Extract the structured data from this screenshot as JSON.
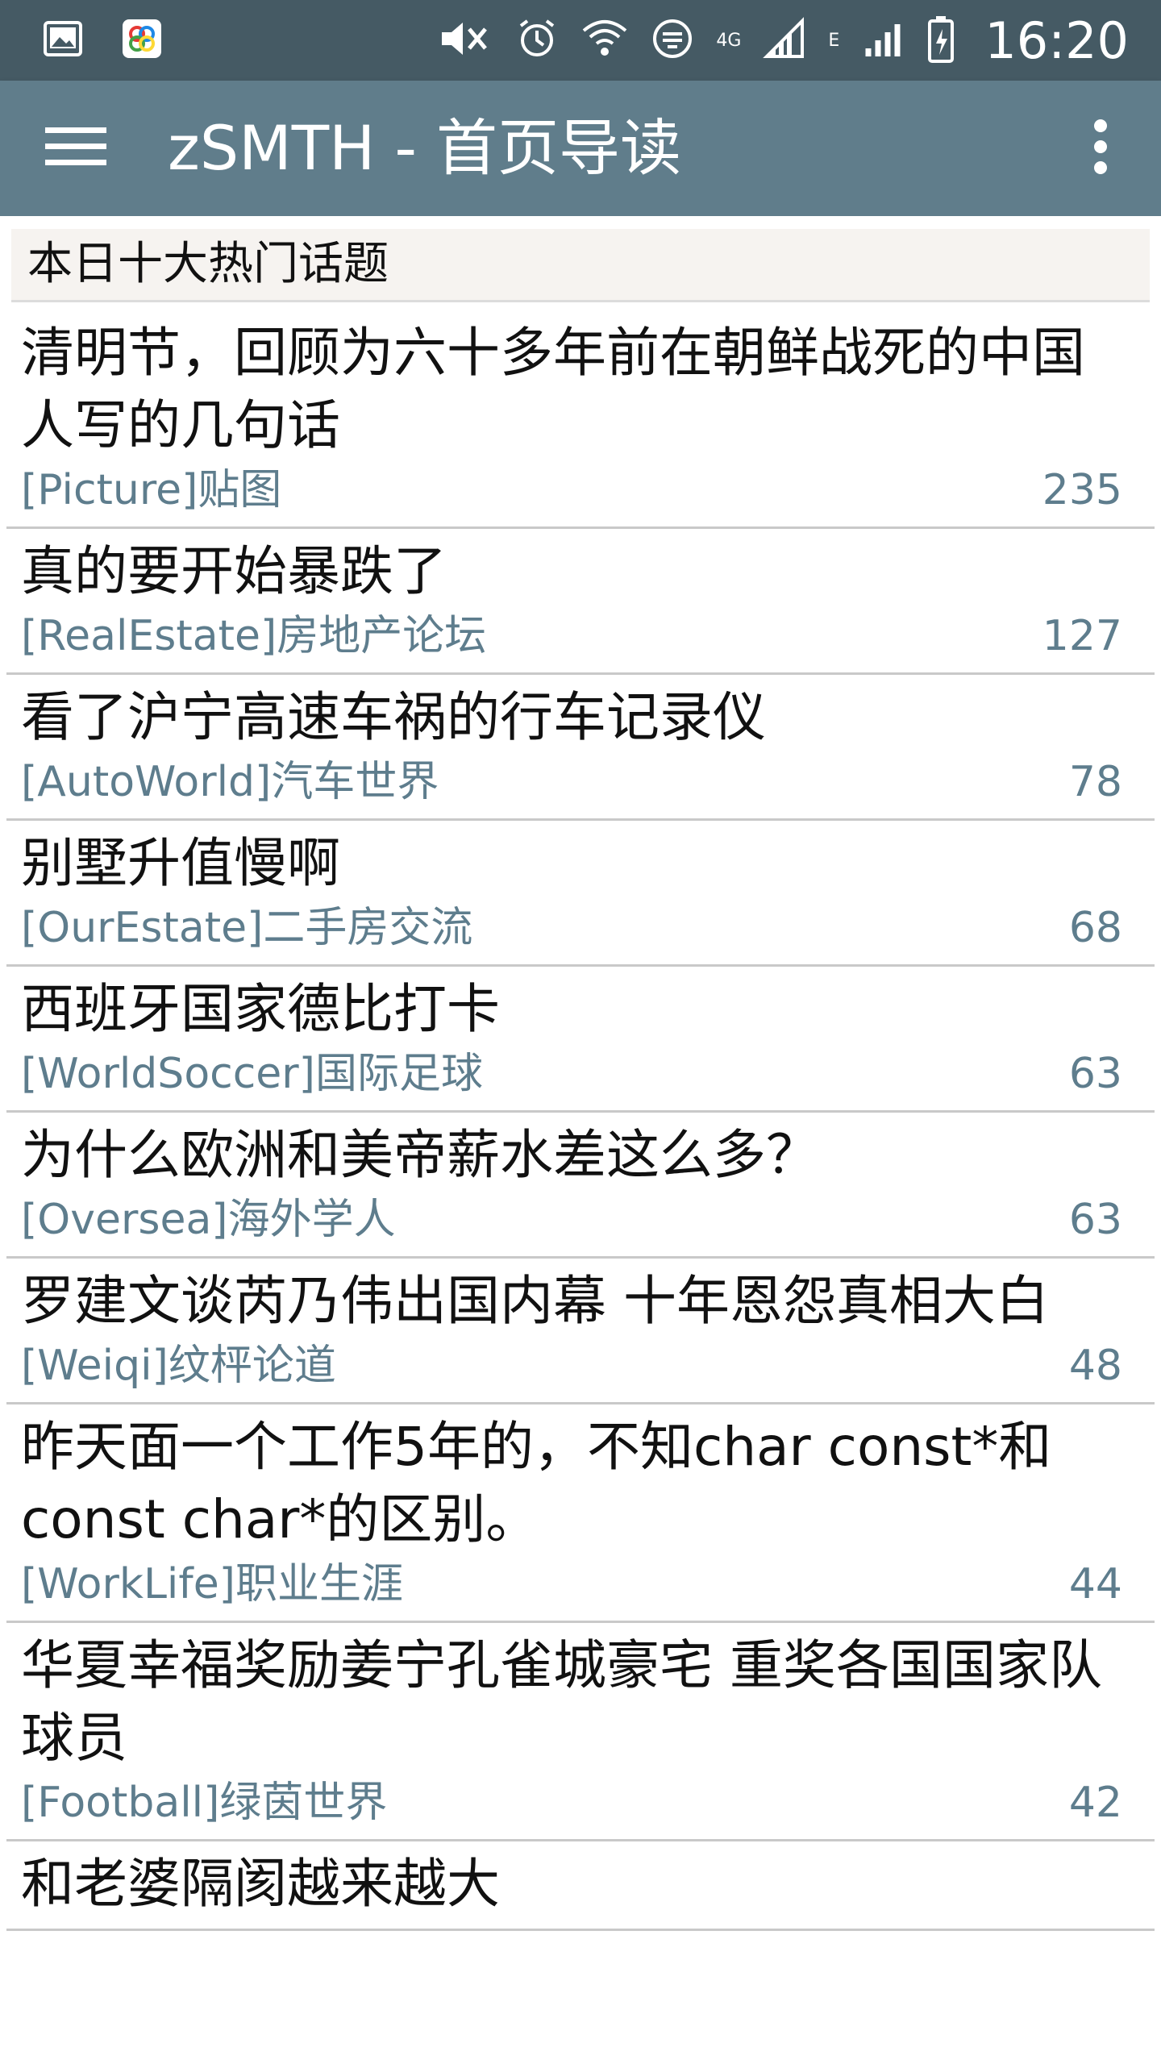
{
  "status_bar": {
    "time": "16:20",
    "network_4g": "4G",
    "network_e": "E",
    "icons": [
      "gallery-icon",
      "app-icon",
      "mute-icon",
      "alarm-icon",
      "wifi-icon",
      "sync-icon",
      "signal-icon",
      "signal-icon",
      "battery-icon"
    ]
  },
  "app_bar": {
    "title": "zSMTH - 首页导读",
    "menu_icon": "hamburger-menu-icon",
    "more_icon": "more-vert-icon"
  },
  "section": {
    "title": "本日十大热门话题"
  },
  "topics": [
    {
      "title": "清明节，回顾为六十多年前在朝鲜战死的中国人写的几句话",
      "board": "[Picture]贴图",
      "count": "235"
    },
    {
      "title": "真的要开始暴跌了",
      "board": "[RealEstate]房地产论坛",
      "count": "127"
    },
    {
      "title": "看了沪宁高速车祸的行车记录仪",
      "board": "[AutoWorld]汽车世界",
      "count": "78"
    },
    {
      "title": "别墅升值慢啊",
      "board": "[OurEstate]二手房交流",
      "count": "68"
    },
    {
      "title": "西班牙国家德比打卡",
      "board": "[WorldSoccer]国际足球",
      "count": "63"
    },
    {
      "title": "为什么欧洲和美帝薪水差这么多？",
      "board": "[Oversea]海外学人",
      "count": "63"
    },
    {
      "title": "罗建文谈芮乃伟出国内幕 十年恩怨真相大白",
      "board": "[Weiqi]纹枰论道",
      "count": "48"
    },
    {
      "title": "昨天面一个工作5年的，不知char const*和const char*的区别。",
      "board": "[WorkLife]职业生涯",
      "count": "44"
    },
    {
      "title": "华夏幸福奖励姜宁孔雀城豪宅 重奖各国国家队球员",
      "board": "[Football]绿茵世界",
      "count": "42"
    },
    {
      "title": "和老婆隔阂越来越大",
      "board": "",
      "count": ""
    }
  ]
}
